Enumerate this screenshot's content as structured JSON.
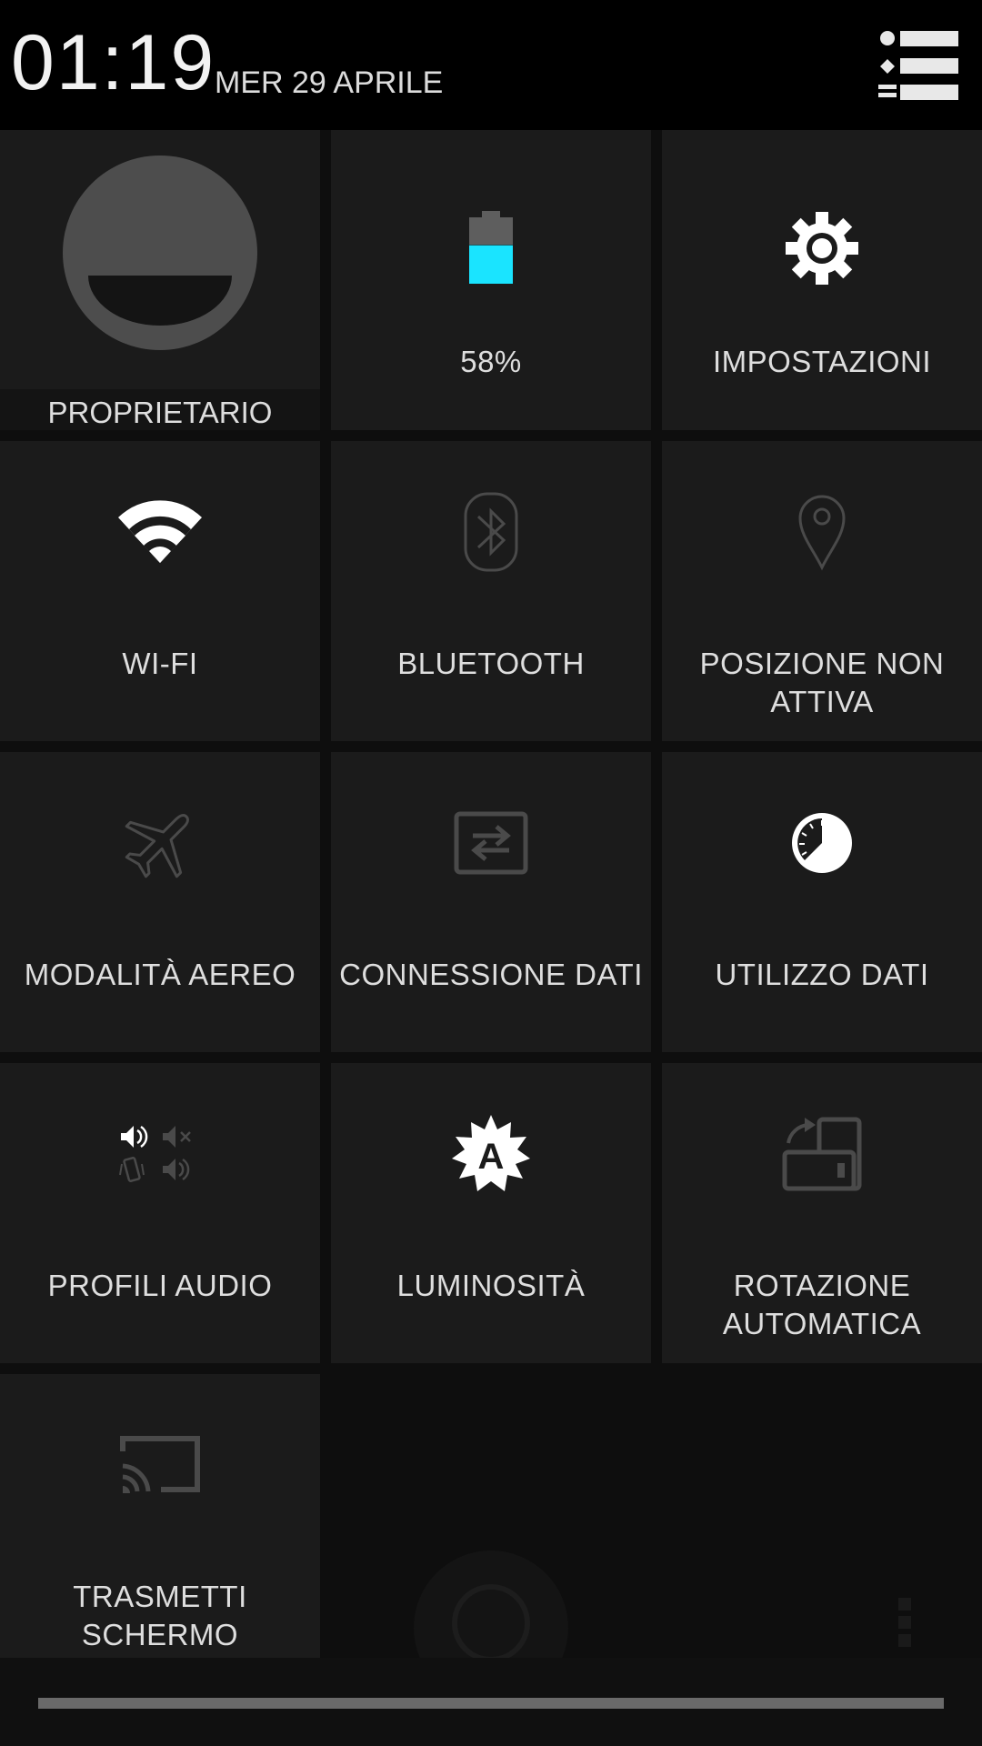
{
  "header": {
    "time": "01:19",
    "date": "MER 29 APRILE"
  },
  "tiles": [
    {
      "id": "owner",
      "label": "PROPRIETARIO",
      "icon": "user-avatar-icon"
    },
    {
      "id": "battery",
      "label": "58%",
      "icon": "battery-icon",
      "battery_level_fraction": 0.58
    },
    {
      "id": "settings",
      "label": "IMPOSTAZIONI",
      "icon": "gear-icon"
    },
    {
      "id": "wifi",
      "label": "WI-FI",
      "icon": "wifi-icon",
      "state": "on"
    },
    {
      "id": "bluetooth",
      "label": "BLUETOOTH",
      "icon": "bluetooth-icon",
      "state": "off"
    },
    {
      "id": "location",
      "label": "POSIZIONE NON ATTIVA",
      "icon": "location-pin-icon",
      "state": "off"
    },
    {
      "id": "airplane",
      "label": "MODALITÀ AEREO",
      "icon": "airplane-icon",
      "state": "off"
    },
    {
      "id": "mobile-data",
      "label": "CONNESSIONE DATI",
      "icon": "data-transfer-icon",
      "state": "off"
    },
    {
      "id": "data-usage",
      "label": "UTILIZZO DATI",
      "icon": "data-usage-icon",
      "state": "on"
    },
    {
      "id": "audio-profiles",
      "label": "PROFILI AUDIO",
      "icon": "audio-profiles-icon"
    },
    {
      "id": "brightness",
      "label": "LUMINOSITÀ",
      "icon": "auto-brightness-icon",
      "state": "on"
    },
    {
      "id": "rotation",
      "label": "ROTAZIONE AUTOMATICA",
      "icon": "screen-rotation-icon",
      "state": "off"
    },
    {
      "id": "cast",
      "label": "TRASMETTI SCHERMO",
      "icon": "cast-screen-icon",
      "state": "off"
    }
  ],
  "colors": {
    "battery_fill": "#1ae4ff",
    "tile_bg": "#1b1b1b",
    "icon_active": "#ffffff",
    "icon_inactive": "#4a4a4a"
  }
}
